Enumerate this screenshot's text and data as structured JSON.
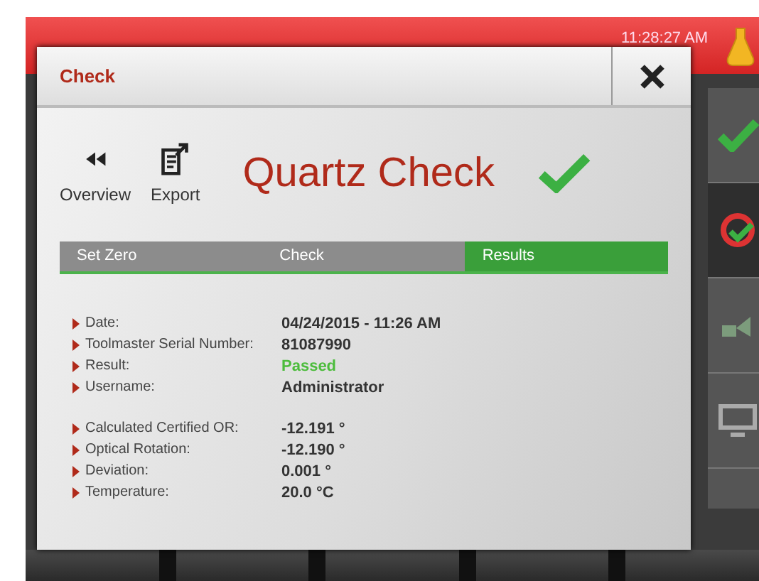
{
  "status_bar": {
    "time": "11:28:27 AM"
  },
  "dialog": {
    "title": "Check",
    "toolbar": [
      {
        "kind": "back",
        "label": "Overview"
      },
      {
        "kind": "export",
        "label": "Export"
      }
    ],
    "heading": "Quartz Check",
    "steps": [
      {
        "label": "Set Zero",
        "selected": false
      },
      {
        "label": "Check",
        "selected": false
      },
      {
        "label": "Results",
        "selected": true
      }
    ],
    "groups": [
      [
        {
          "label": "Date:",
          "value": "04/24/2015 - 11:26 AM",
          "kind": "text"
        },
        {
          "label": "Toolmaster Serial Number:",
          "value": "81087990",
          "kind": "text"
        },
        {
          "label": "Result:",
          "value": "Passed",
          "kind": "status"
        },
        {
          "label": "Username:",
          "value": "Administrator",
          "kind": "text"
        }
      ],
      [
        {
          "label": "Calculated Certified OR:",
          "value": "-12.191 °",
          "kind": "text"
        },
        {
          "label": "Optical Rotation:",
          "value": "-12.190 °",
          "kind": "text"
        },
        {
          "label": "Deviation:",
          "value": "0.001 °",
          "kind": "text"
        },
        {
          "label": "Temperature:",
          "value": "20.0 °C",
          "kind": "text"
        }
      ]
    ]
  }
}
